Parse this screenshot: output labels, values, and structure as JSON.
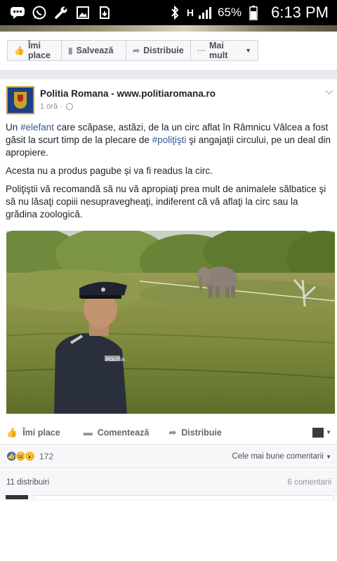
{
  "status_bar": {
    "battery": "65%",
    "time": "6:13 PM",
    "network": "H"
  },
  "prev_post_actions": {
    "like": "Îmi place",
    "save": "Salvează",
    "share": "Distribuie",
    "more": "Mai mult"
  },
  "post": {
    "author": "Politia Romana - www.politiaromana.ro",
    "time": "1 oră",
    "p1": {
      "before": "Un ",
      "hashtag1": "#elefant",
      "middle": " care scăpase, astăzi, de la un circ aflat în Râmnicu Vâlcea a fost găsit la scurt timp de la plecare de ",
      "hashtag2": "#poliţişti",
      "after": " şi angajaţii circului, pe un deal din apropiere."
    },
    "p2": "Acesta nu a produs pagube și va fi readus la circ.",
    "p3": "Poliţiştii vă recomandă să nu vă apropiaţi prea mult de animalele sălbatice şi să nu lăsaţi copiii nesupravegheaţi, indiferent că vă aflaţi la circ sau la grădina zoologică.",
    "photo_label": "POLITIA"
  },
  "actions": {
    "like": "Îmi place",
    "comment": "Comentează",
    "share": "Distribuie"
  },
  "reactions": {
    "count": "172",
    "sort": "Cele mai bune comentarii"
  },
  "stats": {
    "shares": "11 distribuiri",
    "comments": "6 comentarii"
  },
  "colors": {
    "link": "#365899",
    "like_blue": "#4267b2",
    "haha_yellow": "#f7b125"
  }
}
